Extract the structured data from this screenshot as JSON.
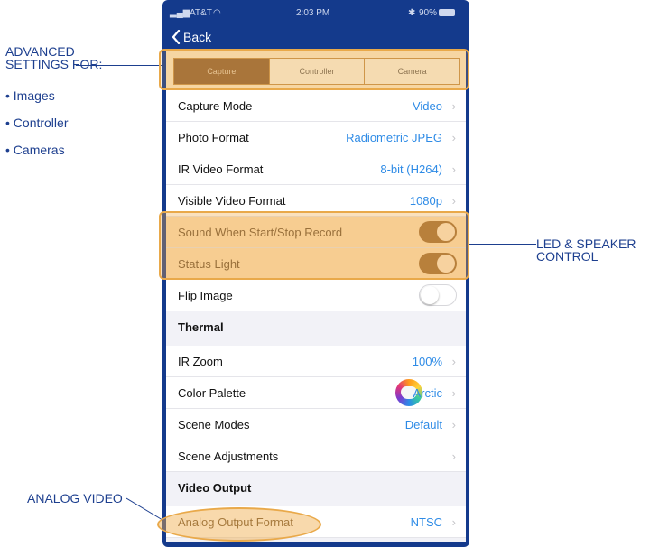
{
  "callouts": {
    "advanced_line1": "ADVANCED",
    "advanced_line2": "SETTINGS FOR:",
    "bullets": [
      "• Images",
      "• Controller",
      "• Cameras"
    ],
    "led_line1": "LED & SPEAKER",
    "led_line2": "CONTROL",
    "analog": "ANALOG VIDEO"
  },
  "statusbar": {
    "carrier": "AT&T",
    "time": "2:03 PM",
    "battery": "90%"
  },
  "nav": {
    "back_label": "Back"
  },
  "tabs": [
    {
      "label": "Capture",
      "active": true
    },
    {
      "label": "Controller",
      "active": false
    },
    {
      "label": "Camera",
      "active": false
    }
  ],
  "rows": {
    "capture_mode": {
      "label": "Capture Mode",
      "value": "Video"
    },
    "photo_format": {
      "label": "Photo Format",
      "value": "Radiometric JPEG"
    },
    "ir_video_format": {
      "label": "IR Video Format",
      "value": "8-bit (H264)"
    },
    "visible_video_format": {
      "label": "Visible Video Format",
      "value": "1080p"
    },
    "sound_record": {
      "label": "Sound When Start/Stop Record",
      "toggle": "on"
    },
    "status_light": {
      "label": "Status Light",
      "toggle": "on"
    },
    "flip_image": {
      "label": "Flip Image",
      "toggle": "off"
    },
    "thermal_header": {
      "label": "Thermal"
    },
    "ir_zoom": {
      "label": "IR Zoom",
      "value": "100%"
    },
    "color_palette": {
      "label": "Color Palette",
      "value": "Arctic",
      "icon": "palette-icon"
    },
    "scene_modes": {
      "label": "Scene Modes",
      "value": "Default"
    },
    "scene_adjustments": {
      "label": "Scene Adjustments",
      "value": ""
    },
    "video_output_header": {
      "label": "Video Output"
    },
    "analog_output_format": {
      "label": "Analog Output Format",
      "value": "NTSC"
    }
  },
  "chevron": "›",
  "colors": {
    "accent_blue": "#2e8be6",
    "nav_blue": "#143a8c",
    "callout_blue": "#1d3f8f",
    "highlight_orange": "#e9a94a",
    "toggle_brown": "#9a6a37"
  }
}
